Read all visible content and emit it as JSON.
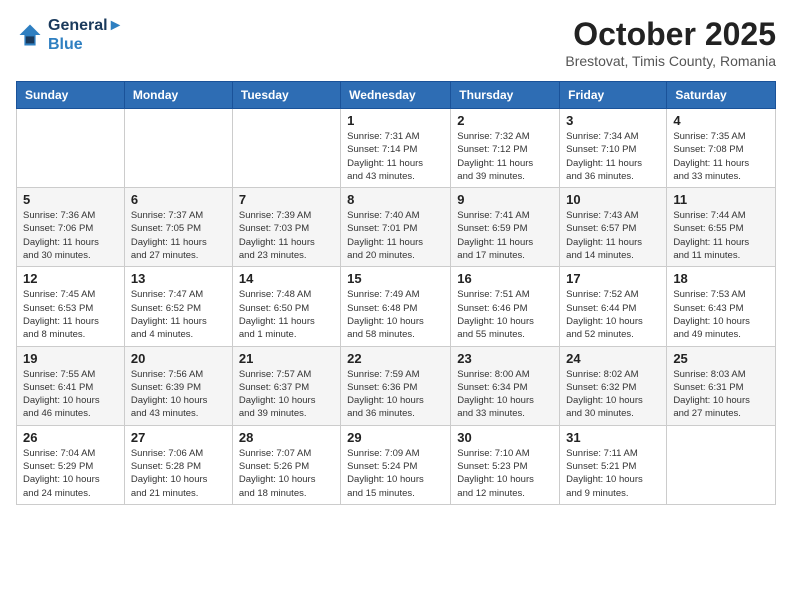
{
  "header": {
    "logo_line1": "General",
    "logo_line2": "Blue",
    "month_title": "October 2025",
    "subtitle": "Brestovat, Timis County, Romania"
  },
  "weekdays": [
    "Sunday",
    "Monday",
    "Tuesday",
    "Wednesday",
    "Thursday",
    "Friday",
    "Saturday"
  ],
  "weeks": [
    [
      {
        "day": "",
        "info": ""
      },
      {
        "day": "",
        "info": ""
      },
      {
        "day": "",
        "info": ""
      },
      {
        "day": "1",
        "info": "Sunrise: 7:31 AM\nSunset: 7:14 PM\nDaylight: 11 hours\nand 43 minutes."
      },
      {
        "day": "2",
        "info": "Sunrise: 7:32 AM\nSunset: 7:12 PM\nDaylight: 11 hours\nand 39 minutes."
      },
      {
        "day": "3",
        "info": "Sunrise: 7:34 AM\nSunset: 7:10 PM\nDaylight: 11 hours\nand 36 minutes."
      },
      {
        "day": "4",
        "info": "Sunrise: 7:35 AM\nSunset: 7:08 PM\nDaylight: 11 hours\nand 33 minutes."
      }
    ],
    [
      {
        "day": "5",
        "info": "Sunrise: 7:36 AM\nSunset: 7:06 PM\nDaylight: 11 hours\nand 30 minutes."
      },
      {
        "day": "6",
        "info": "Sunrise: 7:37 AM\nSunset: 7:05 PM\nDaylight: 11 hours\nand 27 minutes."
      },
      {
        "day": "7",
        "info": "Sunrise: 7:39 AM\nSunset: 7:03 PM\nDaylight: 11 hours\nand 23 minutes."
      },
      {
        "day": "8",
        "info": "Sunrise: 7:40 AM\nSunset: 7:01 PM\nDaylight: 11 hours\nand 20 minutes."
      },
      {
        "day": "9",
        "info": "Sunrise: 7:41 AM\nSunset: 6:59 PM\nDaylight: 11 hours\nand 17 minutes."
      },
      {
        "day": "10",
        "info": "Sunrise: 7:43 AM\nSunset: 6:57 PM\nDaylight: 11 hours\nand 14 minutes."
      },
      {
        "day": "11",
        "info": "Sunrise: 7:44 AM\nSunset: 6:55 PM\nDaylight: 11 hours\nand 11 minutes."
      }
    ],
    [
      {
        "day": "12",
        "info": "Sunrise: 7:45 AM\nSunset: 6:53 PM\nDaylight: 11 hours\nand 8 minutes."
      },
      {
        "day": "13",
        "info": "Sunrise: 7:47 AM\nSunset: 6:52 PM\nDaylight: 11 hours\nand 4 minutes."
      },
      {
        "day": "14",
        "info": "Sunrise: 7:48 AM\nSunset: 6:50 PM\nDaylight: 11 hours\nand 1 minute."
      },
      {
        "day": "15",
        "info": "Sunrise: 7:49 AM\nSunset: 6:48 PM\nDaylight: 10 hours\nand 58 minutes."
      },
      {
        "day": "16",
        "info": "Sunrise: 7:51 AM\nSunset: 6:46 PM\nDaylight: 10 hours\nand 55 minutes."
      },
      {
        "day": "17",
        "info": "Sunrise: 7:52 AM\nSunset: 6:44 PM\nDaylight: 10 hours\nand 52 minutes."
      },
      {
        "day": "18",
        "info": "Sunrise: 7:53 AM\nSunset: 6:43 PM\nDaylight: 10 hours\nand 49 minutes."
      }
    ],
    [
      {
        "day": "19",
        "info": "Sunrise: 7:55 AM\nSunset: 6:41 PM\nDaylight: 10 hours\nand 46 minutes."
      },
      {
        "day": "20",
        "info": "Sunrise: 7:56 AM\nSunset: 6:39 PM\nDaylight: 10 hours\nand 43 minutes."
      },
      {
        "day": "21",
        "info": "Sunrise: 7:57 AM\nSunset: 6:37 PM\nDaylight: 10 hours\nand 39 minutes."
      },
      {
        "day": "22",
        "info": "Sunrise: 7:59 AM\nSunset: 6:36 PM\nDaylight: 10 hours\nand 36 minutes."
      },
      {
        "day": "23",
        "info": "Sunrise: 8:00 AM\nSunset: 6:34 PM\nDaylight: 10 hours\nand 33 minutes."
      },
      {
        "day": "24",
        "info": "Sunrise: 8:02 AM\nSunset: 6:32 PM\nDaylight: 10 hours\nand 30 minutes."
      },
      {
        "day": "25",
        "info": "Sunrise: 8:03 AM\nSunset: 6:31 PM\nDaylight: 10 hours\nand 27 minutes."
      }
    ],
    [
      {
        "day": "26",
        "info": "Sunrise: 7:04 AM\nSunset: 5:29 PM\nDaylight: 10 hours\nand 24 minutes."
      },
      {
        "day": "27",
        "info": "Sunrise: 7:06 AM\nSunset: 5:28 PM\nDaylight: 10 hours\nand 21 minutes."
      },
      {
        "day": "28",
        "info": "Sunrise: 7:07 AM\nSunset: 5:26 PM\nDaylight: 10 hours\nand 18 minutes."
      },
      {
        "day": "29",
        "info": "Sunrise: 7:09 AM\nSunset: 5:24 PM\nDaylight: 10 hours\nand 15 minutes."
      },
      {
        "day": "30",
        "info": "Sunrise: 7:10 AM\nSunset: 5:23 PM\nDaylight: 10 hours\nand 12 minutes."
      },
      {
        "day": "31",
        "info": "Sunrise: 7:11 AM\nSunset: 5:21 PM\nDaylight: 10 hours\nand 9 minutes."
      },
      {
        "day": "",
        "info": ""
      }
    ]
  ]
}
